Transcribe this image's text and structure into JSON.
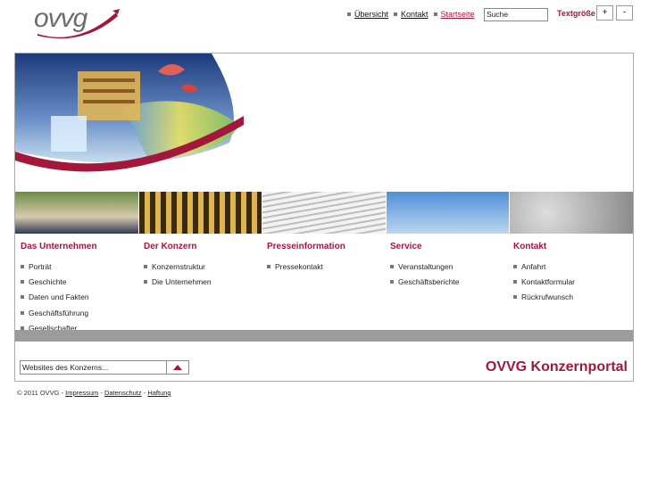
{
  "brand": {
    "logo_text": "ovvg",
    "accent": "#a3173b"
  },
  "topnav": [
    {
      "label": "Übersicht",
      "active": false
    },
    {
      "label": "Kontakt",
      "active": false
    },
    {
      "label": "Startseite",
      "active": true
    }
  ],
  "search": {
    "value": "Suche"
  },
  "text_size": {
    "label": "Textgröße",
    "increase": "+",
    "decrease": "-"
  },
  "menus": [
    {
      "title": "Das Unternehmen",
      "items": [
        "Porträt",
        "Geschichte",
        "Daten und Fakten",
        "Geschäftsführung",
        "Gesellschafter"
      ]
    },
    {
      "title": "Der Konzern",
      "items": [
        "Konzernstruktur",
        "Die Unternehmen"
      ]
    },
    {
      "title": "Presseinformation",
      "items": [
        "Pressekontakt"
      ]
    },
    {
      "title": "Service",
      "items": [
        "Veranstaltungen",
        "Geschäftsberichte"
      ]
    },
    {
      "title": "Kontakt",
      "items": [
        "Anfahrt",
        "Kontaktformular",
        "Rückrufwunsch"
      ]
    }
  ],
  "site_select": {
    "value": "Websites des Konzerns..."
  },
  "portal_title": "OVVG Konzernportal",
  "footer": {
    "copyright": "© 2011 OVVG -",
    "links": [
      "Impressum",
      "Datenschutz",
      "Haftung"
    ]
  }
}
